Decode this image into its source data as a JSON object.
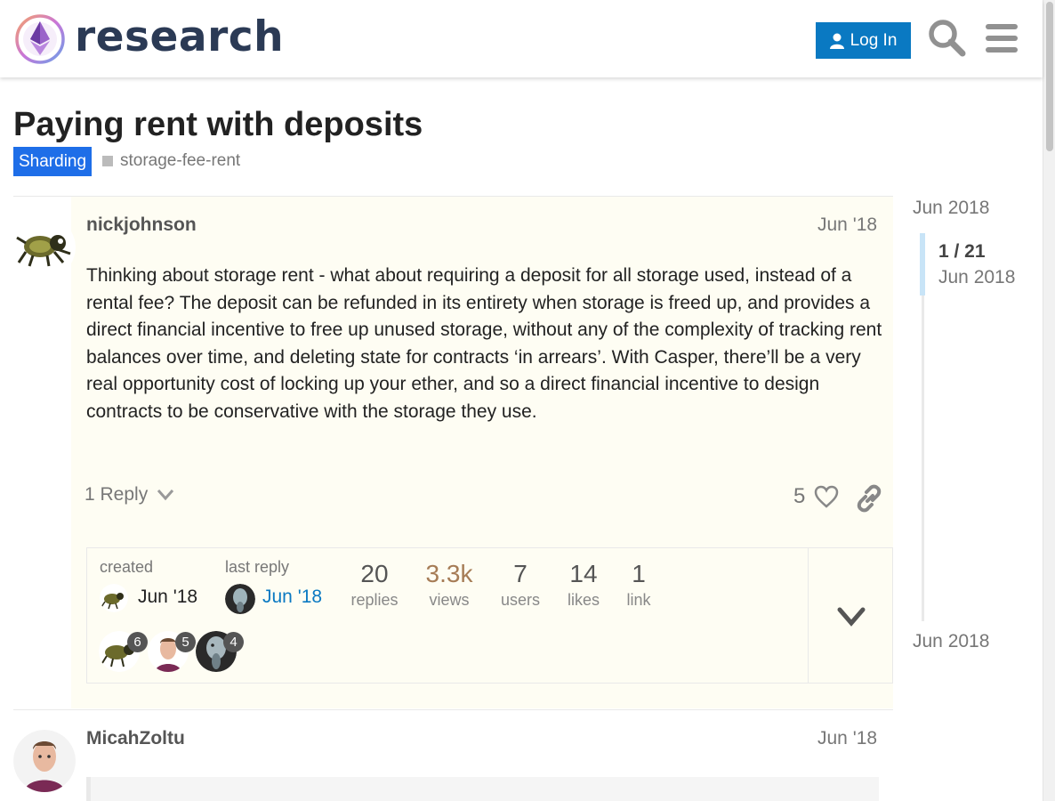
{
  "header": {
    "site_name": "research",
    "login_label": "Log In",
    "search_icon": "search-icon",
    "menu_icon": "hamburger-menu-icon",
    "accent": "#0a79c2"
  },
  "topic": {
    "title": "Paying rent with deposits",
    "category": "Sharding",
    "category_color": "#1e6ee8",
    "tag": "storage-fee-rent"
  },
  "first_post": {
    "username": "nickjohnson",
    "date": "Jun '18",
    "body": "Thinking about storage rent - what about requiring a deposit for all storage used, instead of a rental fee? The deposit can be refunded in its entirety when storage is freed up, and provides a direct financial incentive to free up unused storage, without any of the complexity of tracking rent balances over time, and deleting state for contracts ‘in arrears’. With Casper, there’ll be a very real opportunity cost of locking up your ether, and so a direct financial incentive to design contracts to be conservative with the storage they use.",
    "reply_label": "1 Reply",
    "like_count": "5"
  },
  "topic_map": {
    "created_label": "created",
    "created_date": "Jun '18",
    "last_reply_label": "last reply",
    "last_reply_date": "Jun '18",
    "stats": [
      {
        "value": "20",
        "label": "replies"
      },
      {
        "value": "3.3k",
        "label": "views"
      },
      {
        "value": "7",
        "label": "users"
      },
      {
        "value": "14",
        "label": "likes"
      },
      {
        "value": "1",
        "label": "link"
      }
    ],
    "participants": [
      {
        "count": "6"
      },
      {
        "count": "5"
      },
      {
        "count": "4"
      }
    ]
  },
  "second_post": {
    "username": "MicahZoltu",
    "date": "Jun '18"
  },
  "timeline": {
    "start_date": "Jun 2018",
    "position": "1 / 21",
    "current_date": "Jun 2018",
    "end_date": "Jun 2018"
  }
}
